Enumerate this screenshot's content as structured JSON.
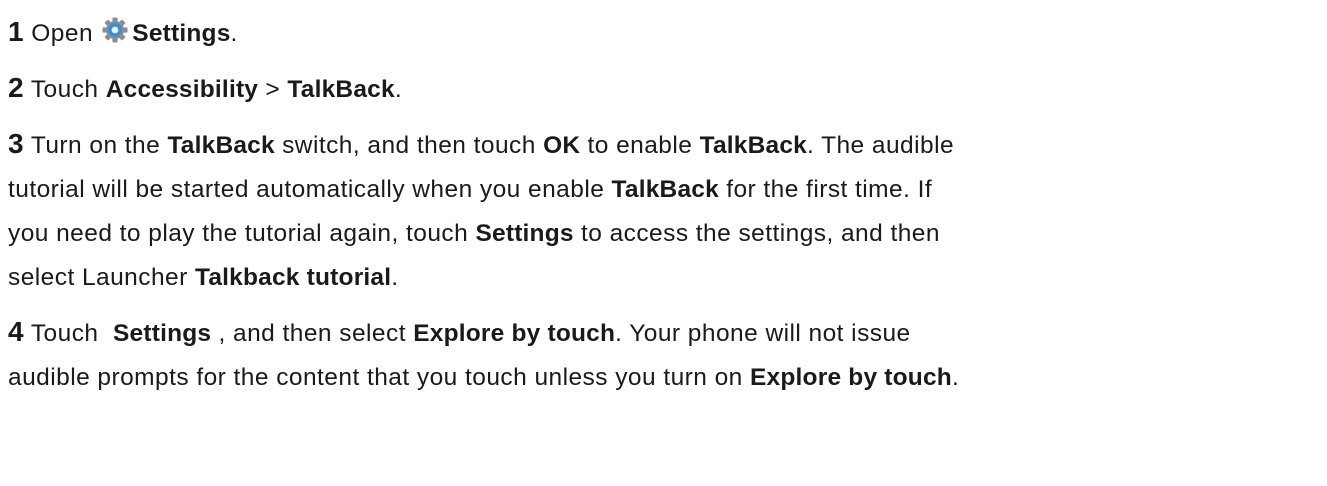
{
  "steps": [
    {
      "number": "1",
      "parts": [
        {
          "text": " Open "
        },
        {
          "icon": "gear-icon"
        },
        {
          "text": "Settings",
          "bold": true
        },
        {
          "text": "."
        }
      ]
    },
    {
      "number": "2",
      "parts": [
        {
          "text": " Touch "
        },
        {
          "text": "Accessibility",
          "bold": true
        },
        {
          "text": " > "
        },
        {
          "text": "TalkBack",
          "bold": true
        },
        {
          "text": "."
        }
      ]
    },
    {
      "number": "3",
      "lines": [
        [
          {
            "text": " Turn on the "
          },
          {
            "text": "TalkBack",
            "bold": true
          },
          {
            "text": " switch, and then touch "
          },
          {
            "text": "OK",
            "bold": true
          },
          {
            "text": " to enable "
          },
          {
            "text": "TalkBack",
            "bold": true
          },
          {
            "text": ". The audible"
          }
        ],
        [
          {
            "text": "tutorial will be started automatically when you enable "
          },
          {
            "text": "TalkBack",
            "bold": true
          },
          {
            "text": " for the first time. If"
          }
        ],
        [
          {
            "text": "you need to play the tutorial again, touch "
          },
          {
            "text": "Settings",
            "bold": true
          },
          {
            "text": " to access the settings, and then"
          }
        ],
        [
          {
            "text": "select Launcher "
          },
          {
            "text": "Talkback tutorial",
            "bold": true
          },
          {
            "text": "."
          }
        ]
      ]
    },
    {
      "number": "4",
      "lines": [
        [
          {
            "text": " Touch  "
          },
          {
            "text": "Settings",
            "bold": true
          },
          {
            "text": " , and then select "
          },
          {
            "text": "Explore by touch",
            "bold": true
          },
          {
            "text": ". Your phone will not issue"
          }
        ],
        [
          {
            "text": "audible prompts for the content that you touch unless you turn on "
          },
          {
            "text": "Explore by touch",
            "bold": true
          },
          {
            "text": "."
          }
        ]
      ]
    }
  ],
  "colors": {
    "text": "#1a1a1a",
    "gear_blue": "#3b8fd0",
    "gear_gray": "#8a8f96"
  }
}
